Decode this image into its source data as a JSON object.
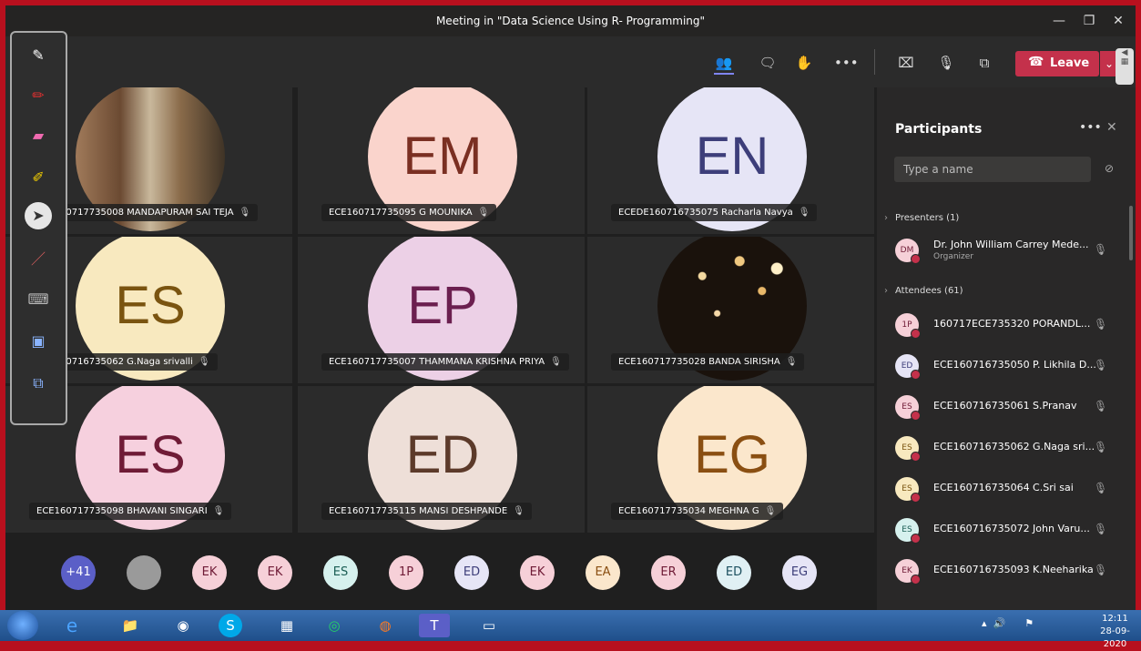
{
  "window": {
    "title": "Meeting in \"Data Science Using R- Programming\""
  },
  "titlebar_buttons": {
    "minimize": "—",
    "restore": "❐",
    "close": "✕"
  },
  "meeting_bar": {
    "leave_label": "Leave",
    "icons": [
      "participants-icon",
      "chat-icon",
      "raise-hand-icon",
      "more-icon",
      "camera-off-icon",
      "mic-off-icon",
      "share-screen-icon"
    ]
  },
  "tiles": [
    {
      "initials": "",
      "photo": "photo1",
      "name": "ECE160717735008 MANDAPURAM SAI TEJA",
      "bg": "#ccc",
      "fg": "#fff"
    },
    {
      "initials": "EM",
      "name": "ECE160717735095 G MOUNIKA",
      "bg": "#fad4cc",
      "fg": "#7a2f22"
    },
    {
      "initials": "EN",
      "name": "ECEDE160716735075 Racharla Navya",
      "bg": "#e6e5f6",
      "fg": "#3d3e7a"
    },
    {
      "initials": "ES",
      "name": "ECE160716735062 G.Naga srivalli",
      "bg": "#f8e9bf",
      "fg": "#7a5410"
    },
    {
      "initials": "EP",
      "name": "ECE160717735007 THAMMANA KRISHNA PRIYA",
      "bg": "#ecd0e6",
      "fg": "#6b1f4f"
    },
    {
      "initials": "",
      "photo": "photo2",
      "name": "ECE160717735028 BANDA SIRISHA",
      "bg": "#222",
      "fg": "#fff"
    },
    {
      "initials": "ES",
      "name": "ECE160717735098 BHAVANI SINGARI",
      "bg": "#f6d0de",
      "fg": "#6f1b36"
    },
    {
      "initials": "ED",
      "name": "ECE160717735115 MANSI DESHPANDE",
      "bg": "#eedfd8",
      "fg": "#5c3a2a"
    },
    {
      "initials": "EG",
      "name": "ECE160717735034 MEGHNA G",
      "bg": "#fbe7cc",
      "fg": "#8a4f12"
    }
  ],
  "bottom_avatars": [
    {
      "label": "+41",
      "bg": "#5b5fc7",
      "fg": "#fff"
    },
    {
      "label": "",
      "bg": "#9a9a9a",
      "fg": "#fff"
    },
    {
      "label": "EK",
      "bg": "#f6d0d8",
      "fg": "#6f1b36"
    },
    {
      "label": "EK",
      "bg": "#f6d0d8",
      "fg": "#6f1b36"
    },
    {
      "label": "ES",
      "bg": "#d6f1ee",
      "fg": "#1b5e55"
    },
    {
      "label": "1P",
      "bg": "#f6d0d8",
      "fg": "#6f1b36"
    },
    {
      "label": "ED",
      "bg": "#e6e5f6",
      "fg": "#3d3e7a"
    },
    {
      "label": "EK",
      "bg": "#f6d0d8",
      "fg": "#6f1b36"
    },
    {
      "label": "EA",
      "bg": "#fbe7cc",
      "fg": "#8a4f12"
    },
    {
      "label": "ER",
      "bg": "#f6d0d8",
      "fg": "#6f1b36"
    },
    {
      "label": "ED",
      "bg": "#e0f0f4",
      "fg": "#1b4e5e"
    },
    {
      "label": "EG",
      "bg": "#e6e5f6",
      "fg": "#3d3e7a"
    }
  ],
  "panel": {
    "title": "Participants",
    "more": "•••",
    "close": "✕",
    "search_placeholder": "Type a name",
    "presenters_header": "Presenters (1)",
    "attendees_header": "Attendees (61)",
    "presenters": [
      {
        "initials": "DM",
        "name": "Dr. John William Carrey Mede...",
        "role": "Organizer",
        "bg": "#f6d0d8",
        "fg": "#6f1b36"
      }
    ],
    "attendees": [
      {
        "initials": "1P",
        "name": "160717ECE735320 PORANDL...",
        "bg": "#f6d0d8",
        "fg": "#6f1b36"
      },
      {
        "initials": "ED",
        "name": "ECE160716735050 P. Likhila D...",
        "bg": "#e6e5f6",
        "fg": "#3d3e7a"
      },
      {
        "initials": "ES",
        "name": "ECE160716735061 S.Pranav",
        "bg": "#f6d0d8",
        "fg": "#6f1b36"
      },
      {
        "initials": "ES",
        "name": "ECE160716735062 G.Naga sri...",
        "bg": "#f8e9bf",
        "fg": "#7a5410"
      },
      {
        "initials": "ES",
        "name": "ECE160716735064 C.Sri sai",
        "bg": "#f8e9bf",
        "fg": "#7a5410"
      },
      {
        "initials": "ES",
        "name": "ECE160716735072 John Varu...",
        "bg": "#d6f1ee",
        "fg": "#1b5e55"
      },
      {
        "initials": "EK",
        "name": "ECE160716735093 K.Neeharika",
        "bg": "#f6d0d8",
        "fg": "#6f1b36"
      }
    ]
  },
  "taskbar": {
    "time": "12:11",
    "date": "28-09-2020"
  },
  "colors": {
    "accent": "#7f85f5",
    "leave": "#c4314b",
    "background": "#1f1f1f"
  }
}
